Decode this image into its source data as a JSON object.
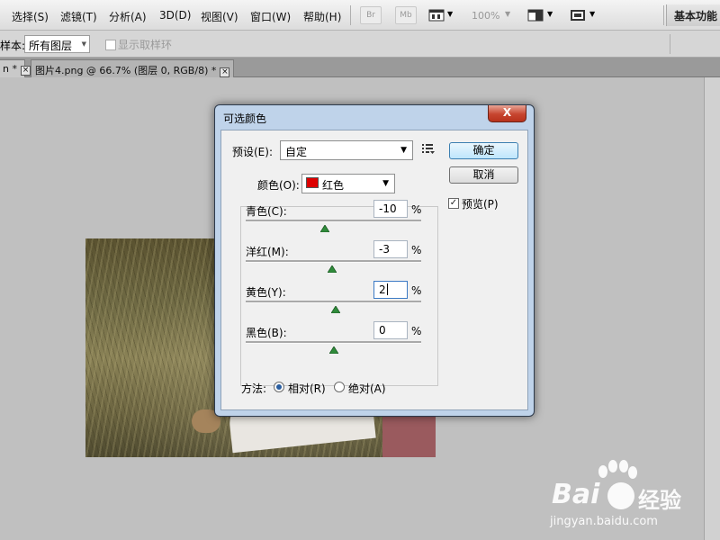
{
  "menubar": {
    "items": [
      "选择(S)",
      "滤镜(T)",
      "分析(A)",
      "3D(D)",
      "视图(V)",
      "窗口(W)",
      "帮助(H)"
    ],
    "br_label": "Br",
    "mb_label": "Mb",
    "zoom": "100%",
    "workspace": "基本功能"
  },
  "options_bar": {
    "sample_label": "样本:",
    "sample_value": "所有图层",
    "show_ring_label": "显示取样环",
    "show_ring_checked": false
  },
  "tabs": {
    "tab1_label": "n *",
    "tab2_label": "图片4.png @ 66.7% (图层 0, RGB/8) *"
  },
  "dialog": {
    "title": "可选颜色",
    "close": "X",
    "preset_label": "预设(E):",
    "preset_value": "自定",
    "ok_label": "确定",
    "cancel_label": "取消",
    "preview_label": "预览(P)",
    "preview_checked": true,
    "colors_label": "颜色(O):",
    "colors_value": "红色",
    "swatch_color": "#dd0000",
    "sliders": [
      {
        "label": "青色(C):",
        "value": "-10",
        "unit": "%"
      },
      {
        "label": "洋红(M):",
        "value": "-3",
        "unit": "%"
      },
      {
        "label": "黄色(Y):",
        "value": "2",
        "unit": "%"
      },
      {
        "label": "黑色(B):",
        "value": "0",
        "unit": "%"
      }
    ],
    "method_label": "方法:",
    "relative_label": "相对(R)",
    "absolute_label": "绝对(A)",
    "method_selected": "relative"
  },
  "watermark": {
    "logo_text": "Bai",
    "logo_tail": "经验",
    "url": "jingyan.baidu.com"
  }
}
